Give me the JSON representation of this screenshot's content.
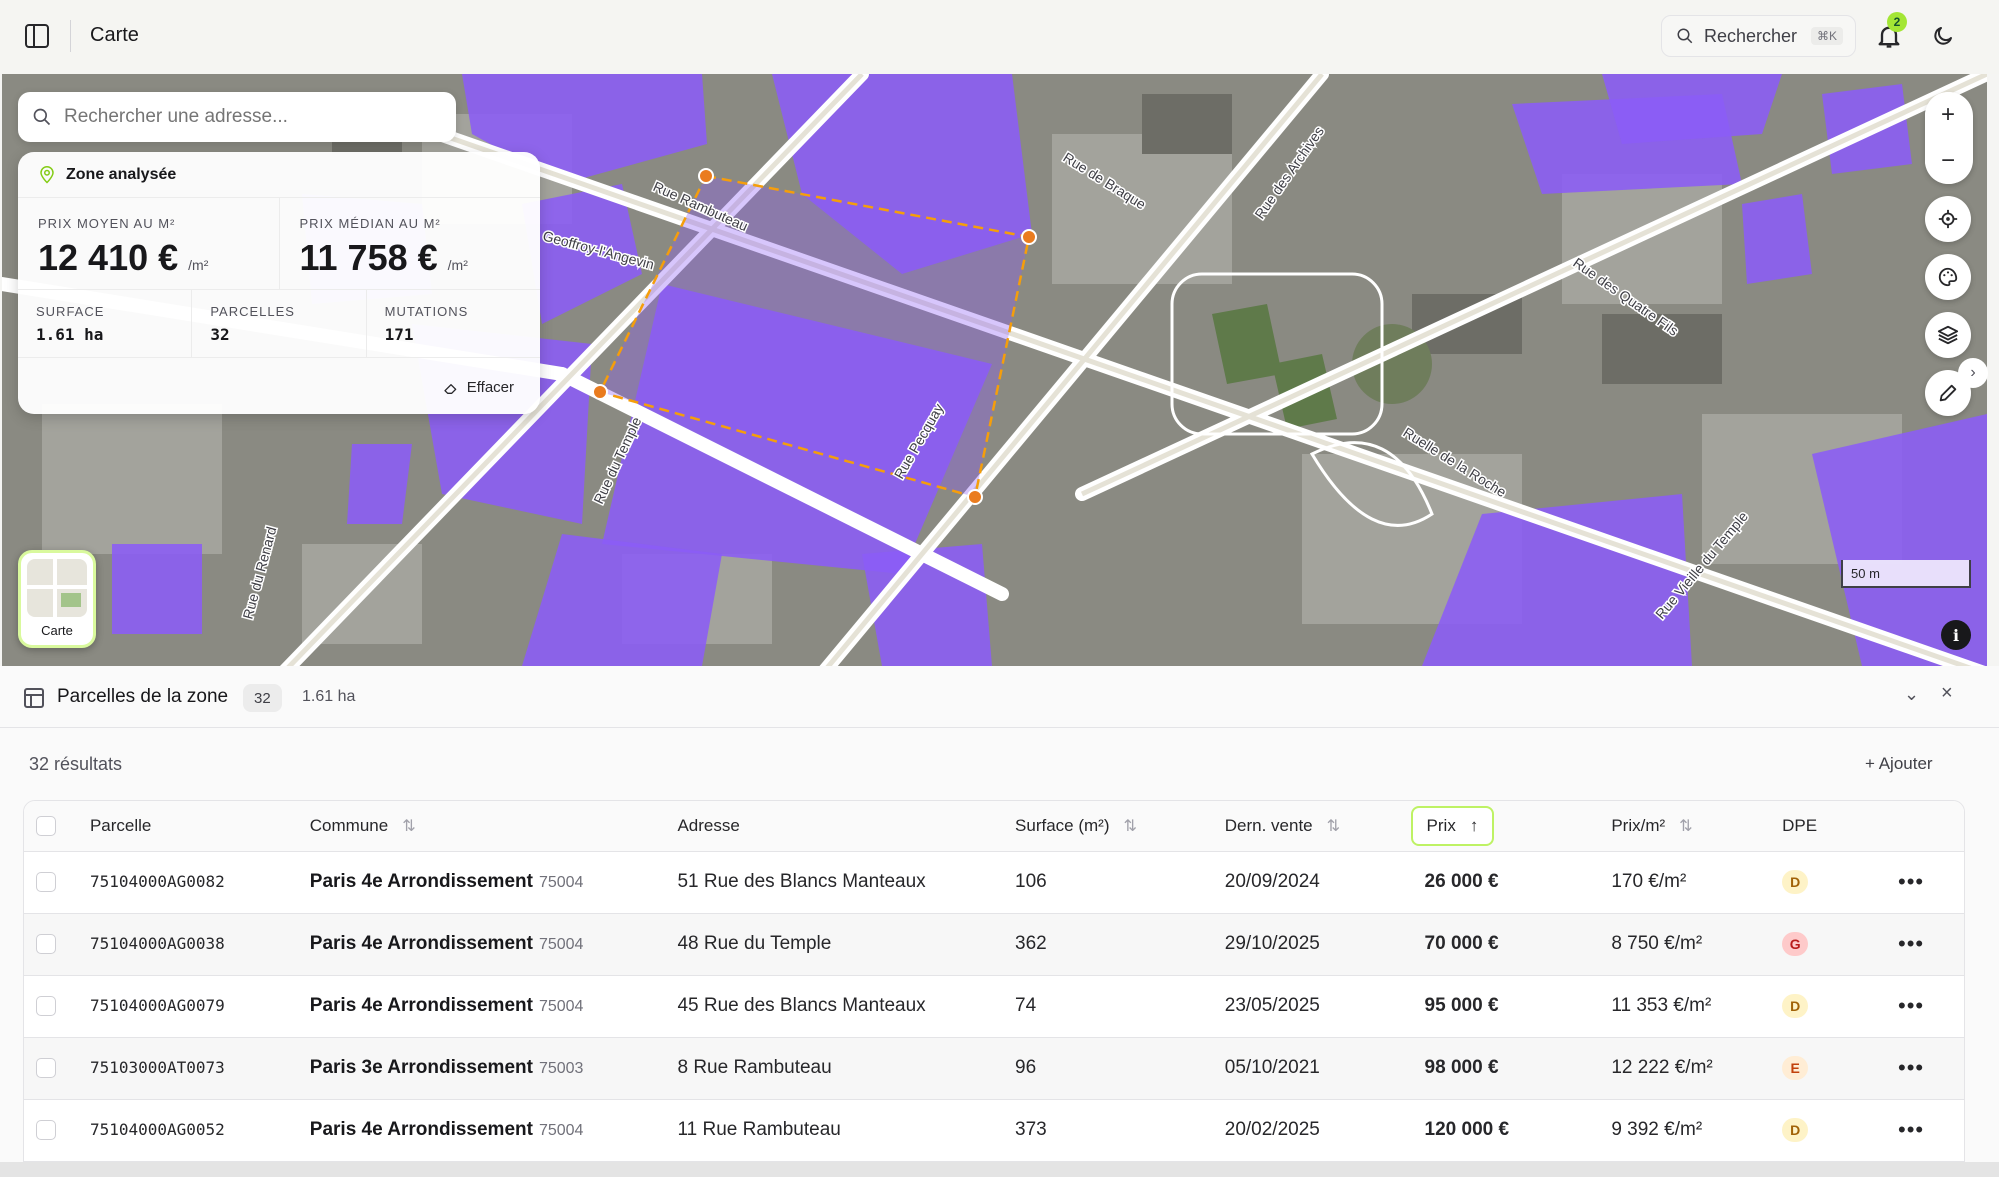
{
  "header": {
    "title": "Carte",
    "search_label": "Rechercher",
    "search_shortcut": "⌘K",
    "notification_count": "2"
  },
  "map": {
    "search_placeholder": "Rechercher une adresse...",
    "zone_card": {
      "title": "Zone analysée",
      "avg_price_label": "PRIX MOYEN AU M²",
      "avg_price_value": "12 410 €",
      "median_price_label": "PRIX MÉDIAN AU M²",
      "median_price_value": "11 758 €",
      "unit": "/m²",
      "surface_label": "SURFACE",
      "surface_value": "1.61 ha",
      "parcelles_label": "PARCELLES",
      "parcelles_value": "32",
      "mutations_label": "MUTATIONS",
      "mutations_value": "171",
      "clear_label": "Effacer"
    },
    "street_labels": [
      "Rue Rambuteau",
      "Rue de Braque",
      "Rue des Archives",
      "Rue des Quatre Fils",
      "Ruelle de la Roche",
      "Rue du Temple",
      "Rue Pecquay",
      "Geoffroy-l'Angevin",
      "Rue Vieille du Temple",
      "Rue du Renard"
    ],
    "scale_label": "50 m",
    "basemap_label": "Carte",
    "colors": {
      "parcel": "#8b5cf6",
      "zone": "#f59e0b"
    }
  },
  "panel": {
    "title": "Parcelles de la zone",
    "count": "32",
    "area": "1.61 ha",
    "results_label": "32 résultats",
    "add_label": "Ajouter",
    "columns": {
      "parcelle": "Parcelle",
      "commune": "Commune",
      "adresse": "Adresse",
      "surface": "Surface (m²)",
      "vente": "Dern. vente",
      "prix": "Prix",
      "prix_m2": "Prix/m²",
      "dpe": "DPE"
    },
    "rows": [
      {
        "parcelle": "75104000AG0082",
        "commune": "Paris 4e Arrondissement",
        "cp": "75004",
        "adresse": "51 Rue des Blancs Manteaux",
        "surface": "106",
        "vente": "20/09/2024",
        "prix": "26 000 €",
        "prix_m2": "170 €/m²",
        "dpe": "D"
      },
      {
        "parcelle": "75104000AG0038",
        "commune": "Paris 4e Arrondissement",
        "cp": "75004",
        "adresse": "48 Rue du Temple",
        "surface": "362",
        "vente": "29/10/2025",
        "prix": "70 000 €",
        "prix_m2": "8 750 €/m²",
        "dpe": "G"
      },
      {
        "parcelle": "75104000AG0079",
        "commune": "Paris 4e Arrondissement",
        "cp": "75004",
        "adresse": "45 Rue des Blancs Manteaux",
        "surface": "74",
        "vente": "23/05/2025",
        "prix": "95 000 €",
        "prix_m2": "11 353 €/m²",
        "dpe": "D"
      },
      {
        "parcelle": "75103000AT0073",
        "commune": "Paris 3e Arrondissement",
        "cp": "75003",
        "adresse": "8 Rue Rambuteau",
        "surface": "96",
        "vente": "05/10/2021",
        "prix": "98 000 €",
        "prix_m2": "12 222 €/m²",
        "dpe": "E"
      },
      {
        "parcelle": "75104000AG0052",
        "commune": "Paris 4e Arrondissement",
        "cp": "75004",
        "adresse": "11 Rue Rambuteau",
        "surface": "373",
        "vente": "20/02/2025",
        "prix": "120 000 €",
        "prix_m2": "9 392 €/m²",
        "dpe": "D"
      }
    ]
  }
}
